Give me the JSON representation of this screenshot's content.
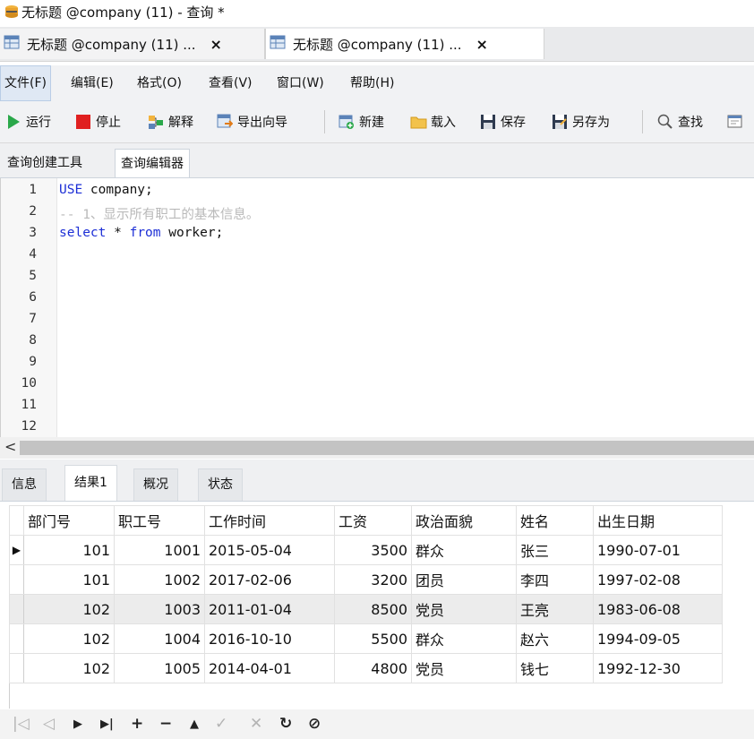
{
  "window": {
    "title": "无标题 @company (11) - 查询 *"
  },
  "doc_tabs": [
    {
      "label": "无标题 @company (11) ...",
      "close": "×"
    },
    {
      "label": "无标题 @company (11) ...",
      "close": "×"
    }
  ],
  "menu": [
    "文件(F)",
    "编辑(E)",
    "格式(O)",
    "查看(V)",
    "窗口(W)",
    "帮助(H)"
  ],
  "toolbar": {
    "run": "运行",
    "stop": "停止",
    "explain": "解释",
    "export_wizard": "导出向导",
    "new": "新建",
    "load": "载入",
    "save": "保存",
    "save_as": "另存为",
    "find": "查找"
  },
  "editor_tabs": [
    "查询创建工具",
    "查询编辑器"
  ],
  "editor": {
    "line_numbers": [
      "1",
      "2",
      "3",
      "4",
      "5",
      "6",
      "7",
      "8",
      "9",
      "10",
      "11",
      "12"
    ],
    "line1_kw": "USE",
    "line1_rest": " company;",
    "line2_comment": "-- 1、显示所有职工的基本信息。",
    "line3_kw1": "select",
    "line3_mid": " * ",
    "line3_kw2": "from",
    "line3_rest": " worker;"
  },
  "scrollbar": {
    "left_arrow": "<"
  },
  "result_tabs": [
    "信息",
    "结果1",
    "概况",
    "状态"
  ],
  "grid": {
    "columns": [
      "部门号",
      "职工号",
      "工作时间",
      "工资",
      "政治面貌",
      "姓名",
      "出生日期"
    ],
    "current_row_marker": "▶",
    "rows": [
      [
        "101",
        "1001",
        "2015-05-04",
        "3500",
        "群众",
        "张三",
        "1990-07-01"
      ],
      [
        "101",
        "1002",
        "2017-02-06",
        "3200",
        "团员",
        "李四",
        "1997-02-08"
      ],
      [
        "102",
        "1003",
        "2011-01-04",
        "8500",
        "党员",
        "王亮",
        "1983-06-08"
      ],
      [
        "102",
        "1004",
        "2016-10-10",
        "5500",
        "群众",
        "赵六",
        "1994-09-05"
      ],
      [
        "102",
        "1005",
        "2014-04-01",
        "4800",
        "党员",
        "钱七",
        "1992-12-30"
      ]
    ]
  },
  "nav": {
    "first": "|◁",
    "prev": "◁",
    "next": "▶",
    "last": "▶|",
    "add": "+",
    "delete": "−",
    "apply": "▲",
    "check": "✓",
    "cancel": "✕",
    "refresh": "↻",
    "stop": "⊘"
  },
  "colors": {
    "keyword": "#1d2fd6",
    "comment": "#b9b9b9",
    "run_green": "#2aa84a",
    "stop_red": "#e02020"
  }
}
